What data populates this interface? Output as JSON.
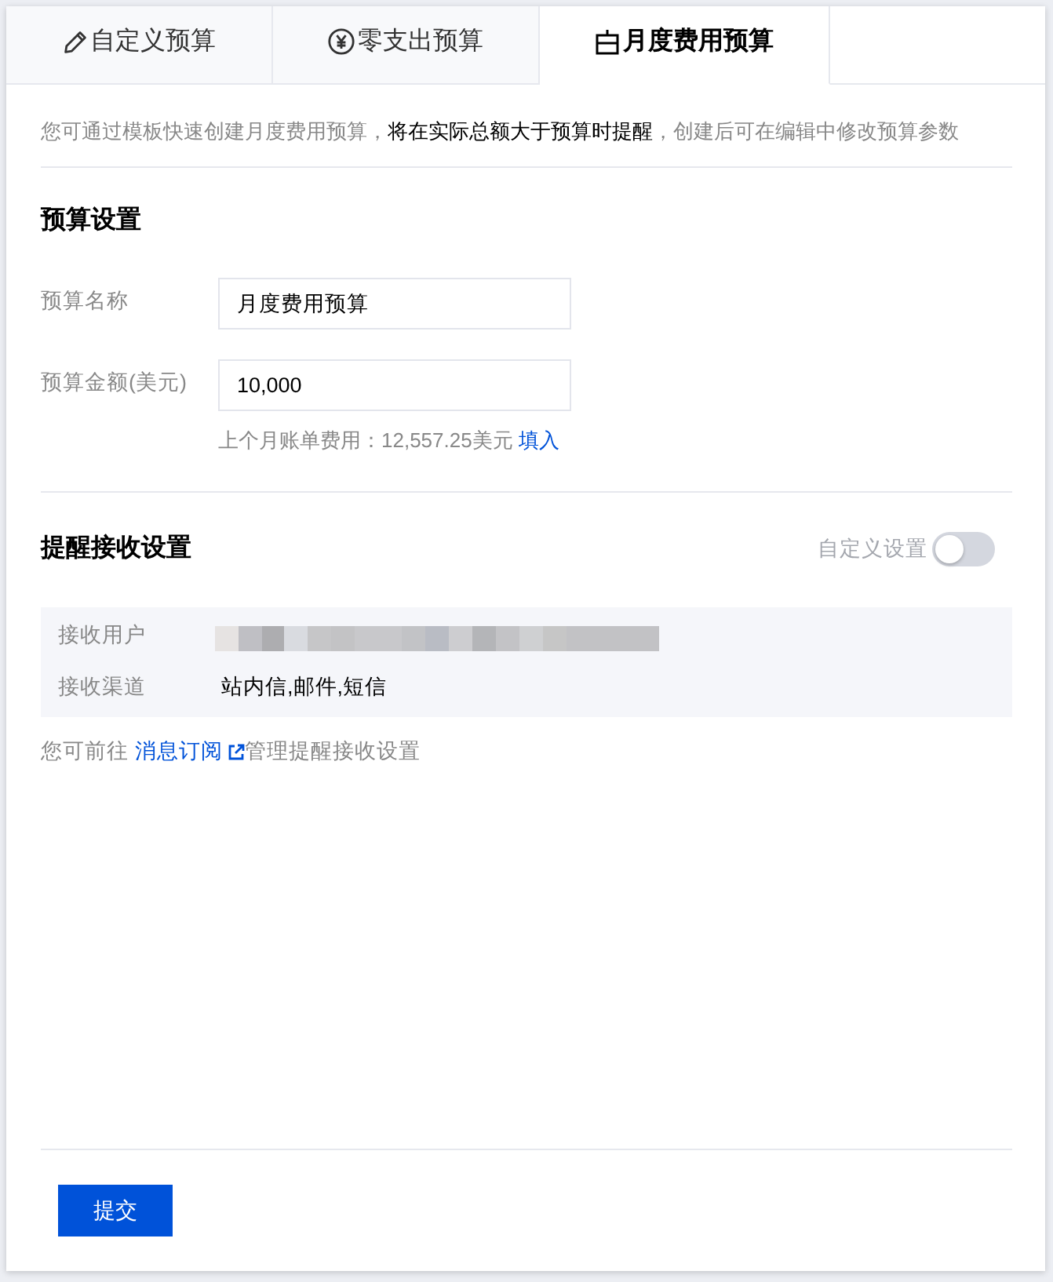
{
  "tabs": [
    {
      "label": "自定义预算",
      "selected": false
    },
    {
      "label": "零支出预算",
      "selected": false
    },
    {
      "label": "月度费用预算",
      "selected": true
    }
  ],
  "description": "您可通过模板快速创建月度费用预算，**将在实际总额大于预算时提醒**，创建后可在编辑中修改预算参数",
  "budget_settings": {
    "title": "预算设置",
    "fields": [
      {
        "label": "预算名称",
        "value": "月度费用预算"
      },
      {
        "label": "预算金额(美元)",
        "value": "10,000"
      }
    ],
    "hint": {
      "text": "上个月账单费用：12,557.25美元",
      "link": "填入"
    }
  },
  "alert_settings": {
    "title": "提醒接收设置",
    "custom_toggle": {
      "label": "自定义设置",
      "on": false
    },
    "rows": [
      {
        "label": "接收用户",
        "kind": "redacted"
      },
      {
        "label": "接收渠道",
        "kind": "text",
        "value": "站内信,邮件,短信"
      }
    ],
    "note": {
      "before": "您可前往",
      "link": "消息订阅",
      "after": "管理提醒接收设置"
    }
  },
  "submit_button": "提交"
}
